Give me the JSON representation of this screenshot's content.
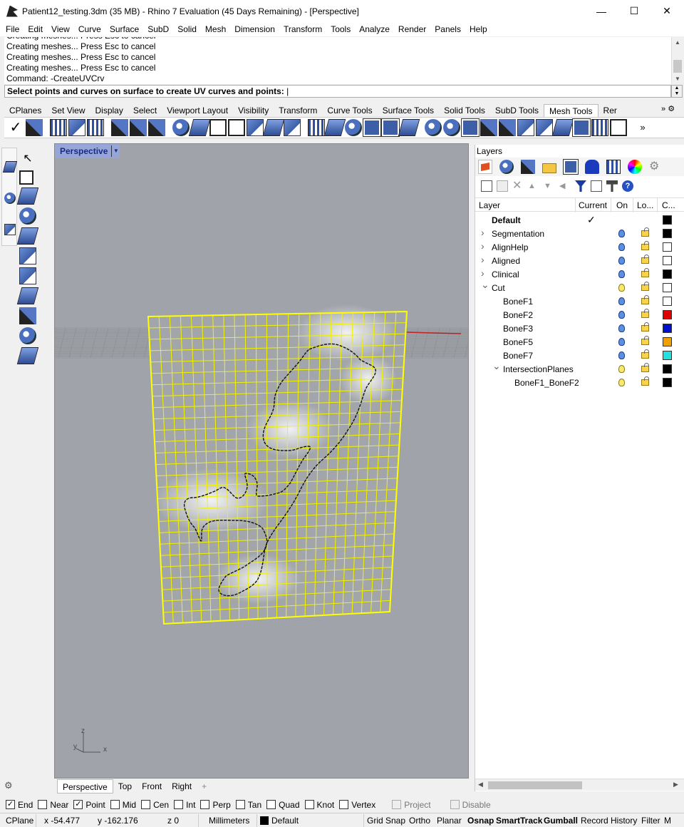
{
  "window": {
    "title": "Patient12_testing.3dm (35 MB) - Rhino 7 Evaluation (45 Days Remaining) - [Perspective]",
    "minimize": "—",
    "maximize": "☐",
    "close": "✕"
  },
  "menu": [
    "File",
    "Edit",
    "View",
    "Curve",
    "Surface",
    "SubD",
    "Solid",
    "Mesh",
    "Dimension",
    "Transform",
    "Tools",
    "Analyze",
    "Render",
    "Panels",
    "Help"
  ],
  "command": {
    "history": [
      "Creating meshes... Press Esc to cancel",
      "Creating meshes... Press Esc to cancel",
      "Creating meshes... Press Esc to cancel",
      "Creating meshes... Press Esc to cancel",
      "Command: -CreateUVCrv"
    ],
    "prompt": "Select points and curves on surface to create UV curves and points:"
  },
  "toolbar_tabs": [
    "CPlanes",
    "Set View",
    "Display",
    "Select",
    "Viewport Layout",
    "Visibility",
    "Transform",
    "Curve Tools",
    "Surface Tools",
    "Solid Tools",
    "SubD Tools",
    "Mesh Tools",
    "Rer"
  ],
  "active_toolbar_tab": "Mesh Tools",
  "toolbar_more": "»",
  "viewport": {
    "label": "Perspective",
    "axis": {
      "x": "x",
      "y": "y",
      "z": "z"
    }
  },
  "viewport_tabs": [
    "Perspective",
    "Top",
    "Front",
    "Right"
  ],
  "viewport_tab_add": "+",
  "layers_panel": {
    "title": "Layers",
    "columns": {
      "layer": "Layer",
      "current": "Current",
      "on": "On",
      "lock": "Lo...",
      "color": "C..."
    },
    "rows": [
      {
        "name": "Default",
        "level": 0,
        "expander": "",
        "current": true,
        "bulb": "none",
        "lock": false,
        "color": "#000000"
      },
      {
        "name": "Segmentation",
        "level": 0,
        "expander": ">",
        "current": false,
        "bulb": "blue",
        "lock": true,
        "color": "#000000"
      },
      {
        "name": "AlignHelp",
        "level": 0,
        "expander": ">",
        "current": false,
        "bulb": "blue",
        "lock": true,
        "color": "#ffffff"
      },
      {
        "name": "Aligned",
        "level": 0,
        "expander": ">",
        "current": false,
        "bulb": "blue",
        "lock": true,
        "color": "#ffffff"
      },
      {
        "name": "Clinical",
        "level": 0,
        "expander": ">",
        "current": false,
        "bulb": "blue",
        "lock": true,
        "color": "#000000"
      },
      {
        "name": "Cut",
        "level": 0,
        "expander": "v",
        "current": false,
        "bulb": "yellow",
        "lock": true,
        "color": "#ffffff"
      },
      {
        "name": "BoneF1",
        "level": 1,
        "expander": "",
        "current": false,
        "bulb": "blue",
        "lock": true,
        "color": "#ffffff"
      },
      {
        "name": "BoneF2",
        "level": 1,
        "expander": "",
        "current": false,
        "bulb": "blue",
        "lock": true,
        "color": "#e00000"
      },
      {
        "name": "BoneF3",
        "level": 1,
        "expander": "",
        "current": false,
        "bulb": "blue",
        "lock": true,
        "color": "#0010d0"
      },
      {
        "name": "BoneF5",
        "level": 1,
        "expander": "",
        "current": false,
        "bulb": "blue",
        "lock": true,
        "color": "#f0a000"
      },
      {
        "name": "BoneF7",
        "level": 1,
        "expander": "",
        "current": false,
        "bulb": "blue",
        "lock": true,
        "color": "#20e0e0"
      },
      {
        "name": "IntersectionPlanes",
        "level": 1,
        "expander": "v",
        "current": false,
        "bulb": "yellow",
        "lock": true,
        "color": "#000000"
      },
      {
        "name": "BoneF1_BoneF2",
        "level": 2,
        "expander": "",
        "current": false,
        "bulb": "yellow",
        "lock": true,
        "color": "#000000"
      }
    ]
  },
  "osnap": [
    {
      "label": "End",
      "checked": true,
      "disabled": false
    },
    {
      "label": "Near",
      "checked": false,
      "disabled": false
    },
    {
      "label": "Point",
      "checked": true,
      "disabled": false
    },
    {
      "label": "Mid",
      "checked": false,
      "disabled": false
    },
    {
      "label": "Cen",
      "checked": false,
      "disabled": false
    },
    {
      "label": "Int",
      "checked": false,
      "disabled": false
    },
    {
      "label": "Perp",
      "checked": false,
      "disabled": false
    },
    {
      "label": "Tan",
      "checked": false,
      "disabled": false
    },
    {
      "label": "Quad",
      "checked": false,
      "disabled": false
    },
    {
      "label": "Knot",
      "checked": false,
      "disabled": false
    },
    {
      "label": "Vertex",
      "checked": false,
      "disabled": false
    },
    {
      "label": "Project",
      "checked": false,
      "disabled": true
    },
    {
      "label": "Disable",
      "checked": false,
      "disabled": true
    }
  ],
  "status": {
    "cplane": "CPlane",
    "x": "x -54.477",
    "y": "y -162.176",
    "z": "z 0",
    "units": "Millimeters",
    "layer": "Default",
    "grid_snap": "Grid Snap",
    "ortho": "Ortho",
    "planar": "Planar",
    "osnap": "Osnap",
    "smarttrack": "SmartTrack",
    "gumball": "Gumball",
    "record_history": "Record History",
    "filter": "Filter",
    "overflow": "M"
  },
  "colors": {
    "viewport_bg": "#a0a4aa",
    "surface_wire": "#ffff00",
    "viewport_label_bg": "#96a6d8",
    "x_axis": "#c02020"
  }
}
